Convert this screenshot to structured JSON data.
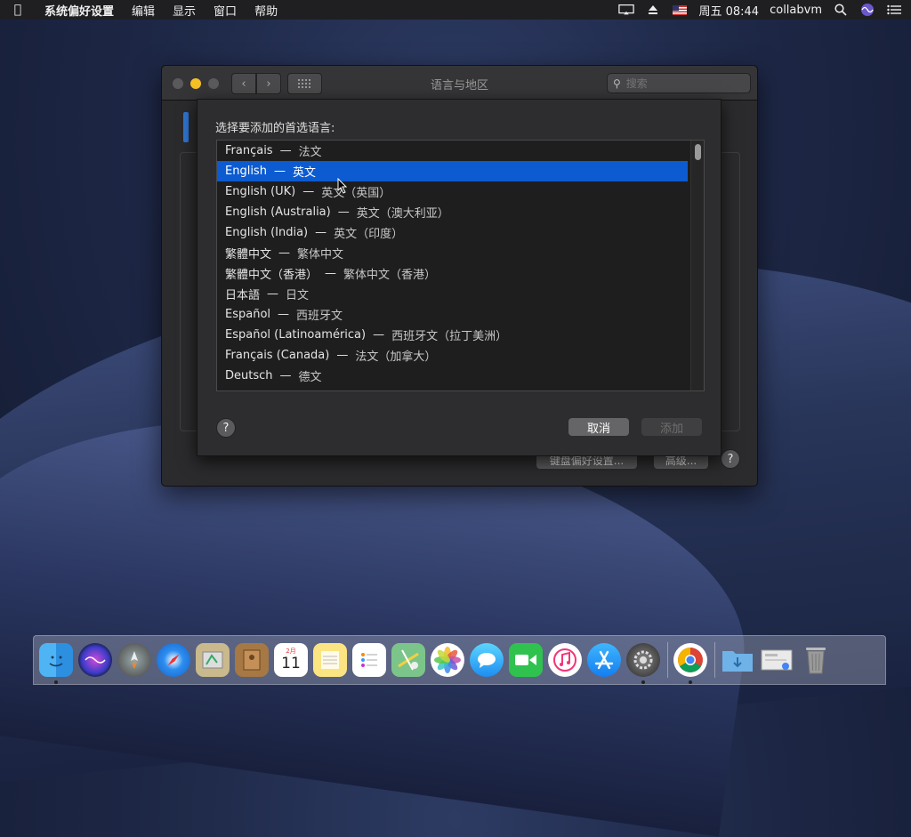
{
  "menubar": {
    "app_name": "系统偏好设置",
    "items": [
      "编辑",
      "显示",
      "窗口",
      "帮助"
    ],
    "clock": "周五 08:44",
    "user": "collabvm"
  },
  "window": {
    "title": "语言与地区",
    "search_placeholder": "搜索",
    "keyboard_prefs_label": "键盘偏好设置...",
    "advanced_label": "高级..."
  },
  "sheet": {
    "title": "选择要添加的首选语言:",
    "languages": [
      {
        "name": "Français",
        "translation": "法文",
        "selected": false
      },
      {
        "name": "English",
        "translation": "英文",
        "selected": true
      },
      {
        "name": "English (UK)",
        "translation": "英文（英国）",
        "selected": false
      },
      {
        "name": "English (Australia)",
        "translation": "英文（澳大利亚）",
        "selected": false
      },
      {
        "name": "English (India)",
        "translation": "英文（印度）",
        "selected": false
      },
      {
        "name": "繁體中文",
        "translation": "繁体中文",
        "selected": false
      },
      {
        "name": "繁體中文（香港）",
        "translation": "繁体中文（香港）",
        "selected": false
      },
      {
        "name": "日本語",
        "translation": "日文",
        "selected": false
      },
      {
        "name": "Español",
        "translation": "西班牙文",
        "selected": false
      },
      {
        "name": "Español (Latinoamérica)",
        "translation": "西班牙文（拉丁美洲）",
        "selected": false
      },
      {
        "name": "Français (Canada)",
        "translation": "法文（加拿大）",
        "selected": false
      },
      {
        "name": "Deutsch",
        "translation": "德文",
        "selected": false
      }
    ],
    "separator": "—",
    "cancel_label": "取消",
    "add_label": "添加",
    "help_label": "?"
  },
  "dock": {
    "apps": [
      "finder-icon",
      "siri-icon",
      "launchpad-icon",
      "safari-icon",
      "mail-icon",
      "contacts-icon",
      "calendar-icon",
      "notes-icon",
      "reminders-icon",
      "maps-icon",
      "photos-icon",
      "messages-icon",
      "facetime-icon",
      "itunes-icon",
      "app-store-icon",
      "system-preferences-icon",
      "chrome-icon"
    ],
    "calendar_month": "2月",
    "calendar_day": "11"
  },
  "colors": {
    "selection": "#0c5bd1",
    "yellow_light": "#f4c025"
  }
}
